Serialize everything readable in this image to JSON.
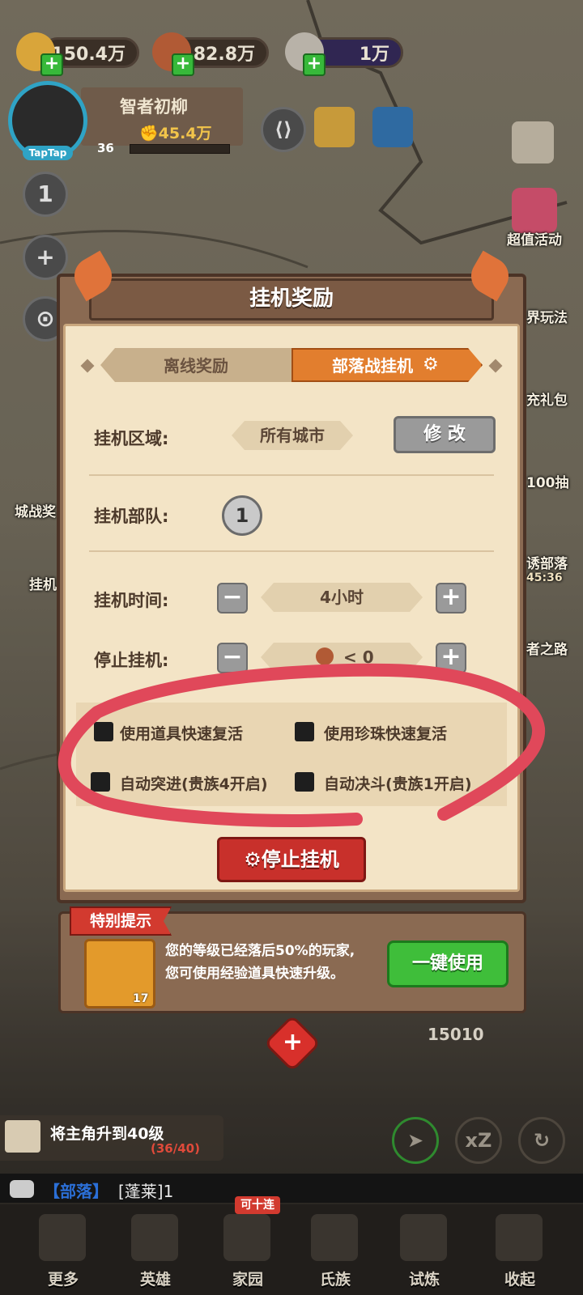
{
  "resources": [
    {
      "icon": "wheat-icon",
      "value": "150.4万"
    },
    {
      "icon": "meat-icon",
      "value": "82.8万"
    },
    {
      "icon": "stone-icon",
      "value": "1万"
    }
  ],
  "player": {
    "name": "智者初柳",
    "power": "45.4万",
    "level": "36",
    "platform_badge": "TapTap",
    "side_number": "1"
  },
  "right_menu": {
    "activity_label": "超值活动",
    "play_label_partial": "界玩法",
    "gift_label_partial": "充礼包",
    "draw_label_partial": "100抽",
    "tribe_label_partial": "诱部落",
    "tribe_timer": "45:36",
    "road_label_partial": "者之路"
  },
  "left_menu": {
    "citywar_partial": "城战奖",
    "idle_partial": "挂机"
  },
  "dialog": {
    "title": "挂机奖励",
    "tab_offline": "离线奖励",
    "tab_tribe_war": "部落战挂机",
    "area_label": "挂机区域:",
    "area_value": "所有城市",
    "modify_button": "修 改",
    "troop_label": "挂机部队:",
    "troop_number": "1",
    "time_label": "挂机时间:",
    "time_value": "4小时",
    "stop_label": "停止挂机:",
    "stop_value": "< 0",
    "options": [
      {
        "label": "使用道具快速复活",
        "checked": false
      },
      {
        "label": "使用珍珠快速复活",
        "checked": false
      },
      {
        "label": "自动突进(贵族4开启)",
        "checked": false
      },
      {
        "label": "自动决斗(贵族1开启)",
        "checked": false
      }
    ],
    "stop_button": "停止挂机"
  },
  "tip": {
    "badge": "特别提示",
    "item_count": "17",
    "line1": "您的等级已经落后50%的玩家,",
    "line2": "您可使用经验道具快速升级。",
    "use_button": "一键使用"
  },
  "score": "15010",
  "quest": {
    "text": "将主角升到40级",
    "progress": "(36/40)"
  },
  "speed_button": "xZ",
  "chat": {
    "channel": "【部落】",
    "message": "[蓬莱]1"
  },
  "nav": {
    "items": [
      {
        "label": "更多",
        "icon": "more-icon"
      },
      {
        "label": "英雄",
        "icon": "hero-icon"
      },
      {
        "label": "家园",
        "icon": "home-icon"
      },
      {
        "label": "氏族",
        "icon": "clan-icon"
      },
      {
        "label": "试炼",
        "icon": "trial-icon"
      },
      {
        "label": "收起",
        "icon": "collapse-icon"
      }
    ],
    "home_badge": "可十连"
  },
  "colors": {
    "dialog_bg": "#f3e4c6",
    "active_tab": "#e27e2e",
    "stop_button": "#c8302b",
    "use_button": "#3fbe3a",
    "annotation": "#e0485a"
  }
}
